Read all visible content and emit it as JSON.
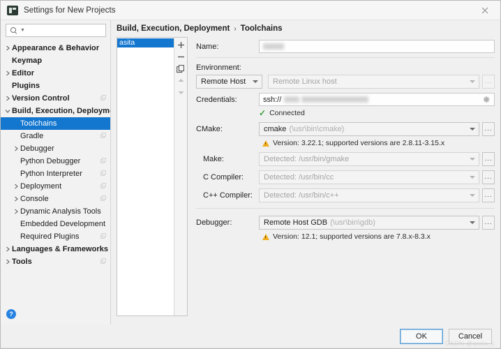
{
  "window": {
    "title": "Settings for New Projects",
    "app_icon": "pycharm-icon",
    "close_label": "✕"
  },
  "search": {
    "placeholder": "",
    "value": "",
    "icon": "search-icon"
  },
  "sidebar": {
    "items": [
      {
        "label": "Appearance & Behavior",
        "arrow": "right",
        "bold": true,
        "indent": 0,
        "scope_icon": false,
        "selected": false
      },
      {
        "label": "Keymap",
        "arrow": "none",
        "bold": true,
        "indent": 0,
        "scope_icon": false,
        "selected": false
      },
      {
        "label": "Editor",
        "arrow": "right",
        "bold": true,
        "indent": 0,
        "scope_icon": false,
        "selected": false
      },
      {
        "label": "Plugins",
        "arrow": "none",
        "bold": true,
        "indent": 0,
        "scope_icon": false,
        "selected": false
      },
      {
        "label": "Version Control",
        "arrow": "right",
        "bold": true,
        "indent": 0,
        "scope_icon": true,
        "selected": false
      },
      {
        "label": "Build, Execution, Deployment",
        "arrow": "down",
        "bold": true,
        "indent": 0,
        "scope_icon": false,
        "selected": false
      },
      {
        "label": "Toolchains",
        "arrow": "none",
        "bold": false,
        "indent": 1,
        "scope_icon": false,
        "selected": true
      },
      {
        "label": "Gradle",
        "arrow": "none",
        "bold": false,
        "indent": 1,
        "scope_icon": true,
        "selected": false
      },
      {
        "label": "Debugger",
        "arrow": "right",
        "bold": false,
        "indent": 1,
        "scope_icon": false,
        "selected": false
      },
      {
        "label": "Python Debugger",
        "arrow": "none",
        "bold": false,
        "indent": 1,
        "scope_icon": true,
        "selected": false
      },
      {
        "label": "Python Interpreter",
        "arrow": "none",
        "bold": false,
        "indent": 1,
        "scope_icon": true,
        "selected": false
      },
      {
        "label": "Deployment",
        "arrow": "right",
        "bold": false,
        "indent": 1,
        "scope_icon": true,
        "selected": false
      },
      {
        "label": "Console",
        "arrow": "right",
        "bold": false,
        "indent": 1,
        "scope_icon": true,
        "selected": false
      },
      {
        "label": "Dynamic Analysis Tools",
        "arrow": "right",
        "bold": false,
        "indent": 1,
        "scope_icon": false,
        "selected": false
      },
      {
        "label": "Embedded Development",
        "arrow": "none",
        "bold": false,
        "indent": 1,
        "scope_icon": false,
        "selected": false
      },
      {
        "label": "Required Plugins",
        "arrow": "none",
        "bold": false,
        "indent": 1,
        "scope_icon": true,
        "selected": false
      },
      {
        "label": "Languages & Frameworks",
        "arrow": "right",
        "bold": true,
        "indent": 0,
        "scope_icon": false,
        "selected": false
      },
      {
        "label": "Tools",
        "arrow": "right",
        "bold": true,
        "indent": 0,
        "scope_icon": true,
        "selected": false
      }
    ],
    "help_label": "?"
  },
  "breadcrumb": {
    "parent": "Build, Execution, Deployment",
    "separator": "›",
    "current": "Toolchains"
  },
  "toolchain_list": {
    "items": [
      {
        "label": "asita",
        "selected": true
      }
    ],
    "toolbar": [
      {
        "name": "add-toolchain-button",
        "glyph": "+",
        "enabled": true
      },
      {
        "name": "remove-toolchain-button",
        "glyph": "−",
        "enabled": true
      },
      {
        "name": "copy-toolchain-button",
        "glyph": "copy",
        "enabled": true
      },
      {
        "name": "move-up-button",
        "glyph": "▲",
        "enabled": false
      },
      {
        "name": "move-down-button",
        "glyph": "▼",
        "enabled": false
      }
    ]
  },
  "form": {
    "name_label": "Name:",
    "name_value": "",
    "environment_label": "Environment:",
    "environment_type": "Remote Host",
    "environment_host": "Remote Linux host",
    "credentials_label": "Credentials:",
    "credentials_prefix": "ssh://",
    "credentials_status": "Connected",
    "cmake_label": "CMake:",
    "cmake_value": "cmake",
    "cmake_path": "(\\usr\\bin\\cmake)",
    "cmake_warning": "Version: 3.22.1; supported versions are 2.8.11-3.15.x",
    "make_label": "Make:",
    "make_value": "Detected: /usr/bin/gmake",
    "c_compiler_label": "C Compiler:",
    "c_compiler_value": "Detected: /usr/bin/cc",
    "cpp_compiler_label": "C++ Compiler:",
    "cpp_compiler_value": "Detected: /usr/bin/c++",
    "debugger_label": "Debugger:",
    "debugger_value": "Remote Host GDB",
    "debugger_path": "(\\usr\\bin\\gdb)",
    "debugger_warning": "Version: 12.1; supported versions are 7.8.x-8.3.x",
    "ellipsis": "...",
    "gear_icon": "gear-icon"
  },
  "footer": {
    "ok_label": "OK",
    "cancel_label": "Cancel",
    "watermark": "CSDN @asita_c"
  },
  "colors": {
    "selection_blue": "#1376cf",
    "warning_amber": "#f0ad1e",
    "success_green": "#3a9e3a",
    "help_blue": "#2681e0"
  }
}
